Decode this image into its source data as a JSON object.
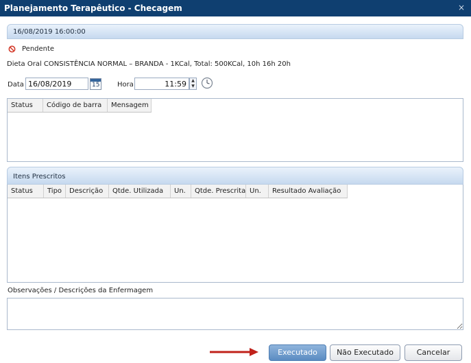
{
  "window": {
    "title": "Planejamento Terapêutico - Checagem",
    "close_label": "×"
  },
  "header_datetime": "16/08/2019 16:00:00",
  "status": {
    "label": "Pendente",
    "color": "#d43b2b"
  },
  "diet_text": "Dieta Oral CONSISTÊNCIA NORMAL – BRANDA - 1KCal, Total: 500KCal, 10h 16h 20h",
  "date_field": {
    "label": "Data",
    "value": "16/08/2019",
    "calendar_day": "15"
  },
  "time_field": {
    "label": "Hora",
    "value": "11:59"
  },
  "barcode_grid": {
    "columns": [
      "Status",
      "Código de barra",
      "Mensagem"
    ]
  },
  "items_section": {
    "title": "Itens Prescritos",
    "columns": [
      "Status",
      "Tipo",
      "Descrição",
      "Qtde. Utilizada",
      "Un.",
      "Qtde. Prescrita",
      "Un.",
      "Resultado Avaliação"
    ]
  },
  "observations": {
    "label": "Observações / Descrições da Enfermagem",
    "value": ""
  },
  "buttons": {
    "executed": "Executado",
    "not_executed": "Não Executado",
    "cancel": "Cancelar"
  },
  "colors": {
    "titlebar": "#0f3f70",
    "primary_button": "#5b8cc2",
    "arrow": "#c0211a"
  }
}
